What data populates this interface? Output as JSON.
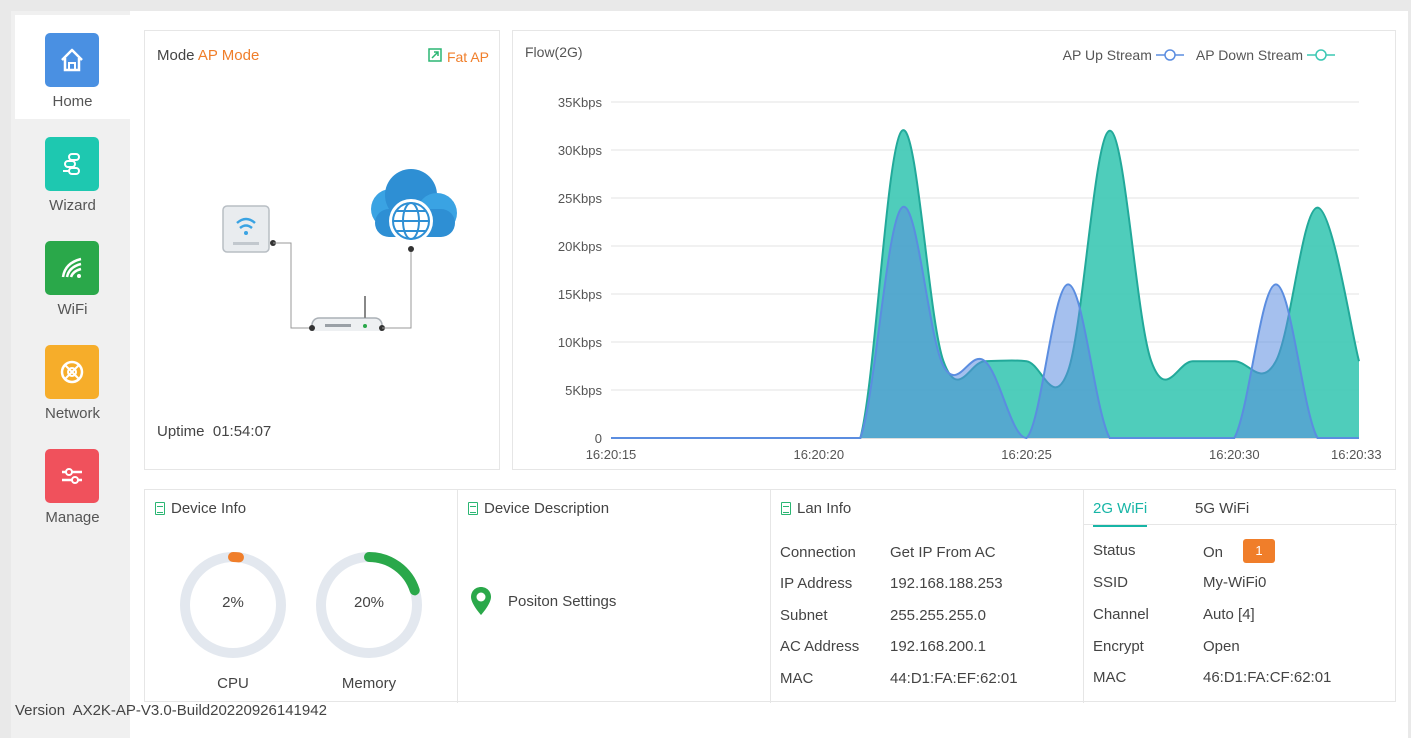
{
  "sidebar": {
    "items": [
      {
        "label": "Home",
        "icon": "home-icon",
        "color": "#4a90e2"
      },
      {
        "label": "Wizard",
        "icon": "wizard-icon",
        "color": "#1ec8b0"
      },
      {
        "label": "WiFi",
        "icon": "wifi-icon",
        "color": "#2aa84a"
      },
      {
        "label": "Network",
        "icon": "network-icon",
        "color": "#f6ad2a"
      },
      {
        "label": "Manage",
        "icon": "manage-icon",
        "color": "#f0515c"
      }
    ]
  },
  "mode": {
    "label": "Mode",
    "value": "AP Mode",
    "switch_label": "Fat AP",
    "uptime_label": "Uptime",
    "uptime_value": "01:54:07"
  },
  "flow": {
    "title": "Flow(2G)",
    "legend_up": "AP Up Stream",
    "legend_down": "AP Down Stream"
  },
  "chart_data": {
    "type": "area",
    "title": "Flow(2G)",
    "x": [
      "16:20:15",
      "16:20:16",
      "16:20:17",
      "16:20:18",
      "16:20:19",
      "16:20:20",
      "16:20:21",
      "16:20:22",
      "16:20:23",
      "16:20:24",
      "16:20:25",
      "16:20:26",
      "16:20:27",
      "16:20:28",
      "16:20:29",
      "16:20:30",
      "16:20:31",
      "16:20:32",
      "16:20:33"
    ],
    "x_ticks": [
      "16:20:15",
      "16:20:20",
      "16:20:25",
      "16:20:30",
      "16:20:33"
    ],
    "y_ticks": [
      "0",
      "5Kbps",
      "10Kbps",
      "15Kbps",
      "20Kbps",
      "25Kbps",
      "30Kbps",
      "35Kbps"
    ],
    "ylim": [
      0,
      35
    ],
    "series": [
      {
        "name": "AP Up Stream",
        "color": "#3cc8b4",
        "values": [
          0,
          0,
          0,
          0,
          0,
          0,
          0,
          32,
          8,
          8,
          8,
          7,
          32,
          8,
          8,
          8,
          8,
          24,
          8
        ]
      },
      {
        "name": "AP Down Stream",
        "color": "#5b8de0",
        "values": [
          0,
          0,
          0,
          0,
          0,
          0,
          0,
          24,
          7.5,
          8,
          0,
          16,
          0,
          0,
          0,
          0,
          16,
          0,
          0
        ]
      }
    ],
    "grid": true,
    "legend": "top-right"
  },
  "device_info": {
    "title": "Device Info",
    "cpu_label": "CPU",
    "cpu_value": "2%",
    "cpu_percent": 2,
    "memory_label": "Memory",
    "memory_value": "20%",
    "memory_percent": 20,
    "cpu_color": "#f07e2a",
    "memory_color": "#2aa84a"
  },
  "device_description": {
    "title": "Device Description",
    "position_label": "Positon Settings"
  },
  "lan_info": {
    "title": "Lan Info",
    "rows": [
      {
        "key": "Connection",
        "value": "Get IP From AC"
      },
      {
        "key": "IP Address",
        "value": "192.168.188.253"
      },
      {
        "key": "Subnet",
        "value": "255.255.255.0"
      },
      {
        "key": "AC Address",
        "value": "192.168.200.1"
      },
      {
        "key": "MAC",
        "value": "44:D1:FA:EF:62:01"
      }
    ]
  },
  "wifi": {
    "tabs": [
      "2G WiFi",
      "5G WiFi"
    ],
    "status_key": "Status",
    "status_value": "On",
    "status_badge": "1",
    "rows": [
      {
        "key": "SSID",
        "value": "My-WiFi0"
      },
      {
        "key": "Channel",
        "value": "Auto [4]"
      },
      {
        "key": "Encrypt",
        "value": "Open"
      },
      {
        "key": "MAC",
        "value": "46:D1:FA:CF:62:01"
      }
    ]
  },
  "footer": {
    "version_label": "Version",
    "version_value": "AX2K-AP-V3.0-Build20220926141942"
  }
}
